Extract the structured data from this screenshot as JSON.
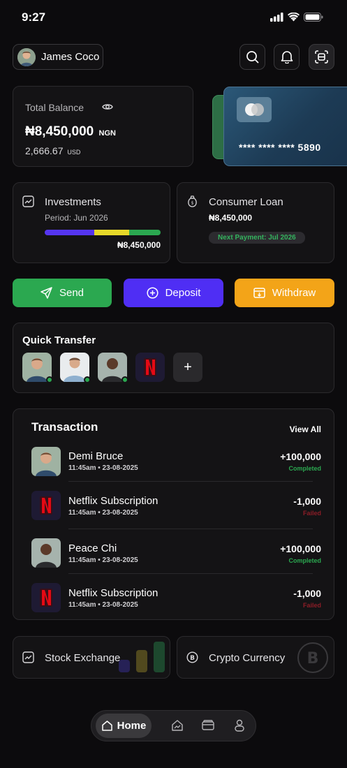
{
  "status_bar": {
    "time": "9:27"
  },
  "header": {
    "user_name": "James Coco"
  },
  "balance": {
    "label": "Total Balance",
    "amount": "₦8,450,000",
    "currency": "NGN",
    "usd_amount": "2,666.67",
    "usd_label": "USD"
  },
  "card": {
    "number": "**** **** **** 5890"
  },
  "investments": {
    "title": "Investments",
    "period": "Period: Jun 2026",
    "amount": "₦8,450,000",
    "progress_segments": [
      0.43,
      0.3,
      0.27
    ]
  },
  "loan": {
    "title": "Consumer Loan",
    "amount": "₦8,450,000",
    "next_payment": "Next Payment: Jul 2026"
  },
  "actions": {
    "send": "Send",
    "deposit": "Deposit",
    "withdraw": "Withdraw"
  },
  "quick_transfer": {
    "title": "Quick Transfer",
    "add_label": "+"
  },
  "transactions": {
    "title": "Transaction",
    "view_all": "View All",
    "rows": [
      {
        "name": "Demi Bruce",
        "date": "11:45am • 23-08-2025",
        "amount": "+100,000",
        "status": "Completed"
      },
      {
        "name": "Netflix Subscription",
        "date": "11:45am • 23-08-2025",
        "amount": "-1,000",
        "status": "Failed"
      },
      {
        "name": "Peace Chi",
        "date": "11:45am • 23-08-2025",
        "amount": "+100,000",
        "status": "Completed"
      },
      {
        "name": "Netflix Subscription",
        "date": "11:45am • 23-08-2025",
        "amount": "-1,000",
        "status": "Failed"
      }
    ]
  },
  "bottom_cards": {
    "stock": "Stock Exchange",
    "crypto": "Crypto Currency"
  },
  "nav": {
    "home": "Home"
  },
  "colors": {
    "green": "#2ba850",
    "purple": "#4f2ef4",
    "orange": "#f3a418",
    "failed": "#8c1d27"
  }
}
